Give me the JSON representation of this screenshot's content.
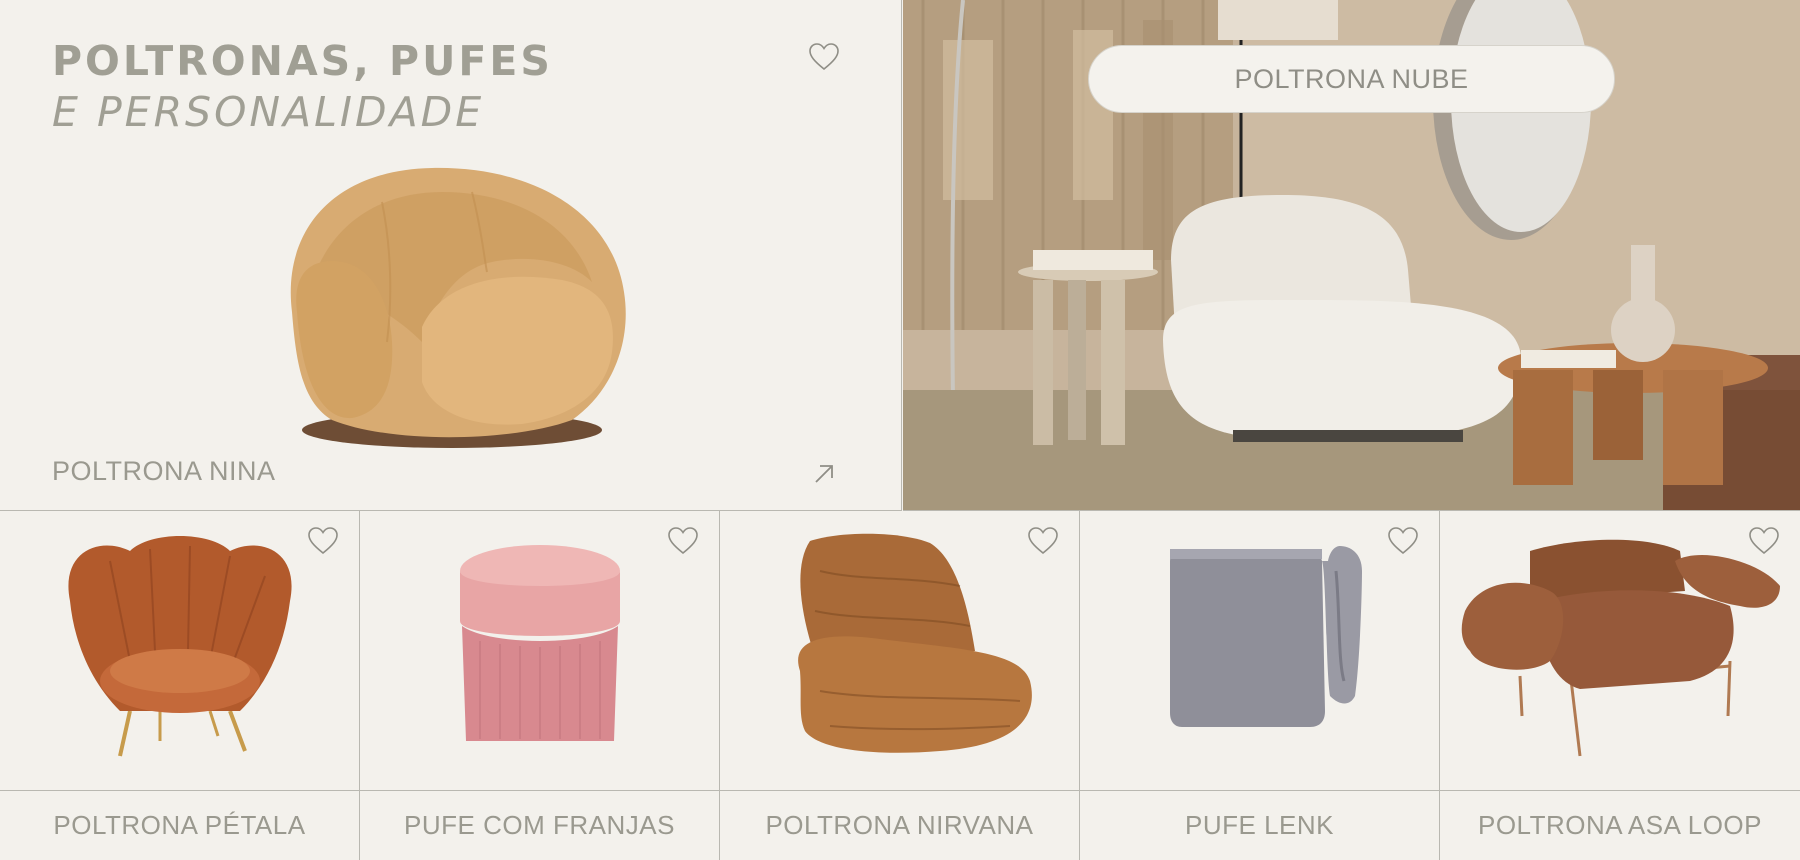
{
  "hero": {
    "headline_line1": "POLTRONAS, PUFES",
    "headline_line2": "E PERSONALIDADE",
    "featured_product": "POLTRONA NINA",
    "ambient_product": "POLTRONA NUBE"
  },
  "products": [
    {
      "name": "POLTRONA PÉTALA"
    },
    {
      "name": "PUFE COM FRANJAS"
    },
    {
      "name": "POLTRONA NIRVANA"
    },
    {
      "name": "PUFE LENK"
    },
    {
      "name": "POLTRONA ASA LOOP"
    }
  ],
  "icons": {
    "favorite": "heart-outline-icon",
    "open": "arrow-up-right-icon"
  },
  "colors": {
    "background": "#f3f1ec",
    "text": "#9a998f",
    "divider": "#b9b8b1"
  }
}
